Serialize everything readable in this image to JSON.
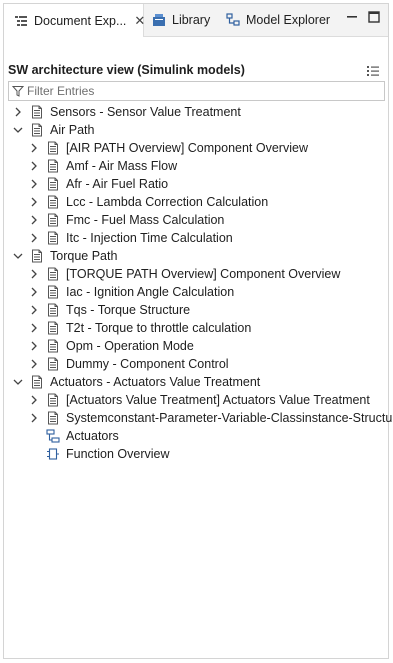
{
  "tabs": [
    {
      "label": "Document Exp...",
      "icon": "tree-view-icon"
    },
    {
      "label": "Library",
      "icon": "library-icon"
    },
    {
      "label": "Model Explorer",
      "icon": "model-explorer-icon"
    }
  ],
  "view": {
    "title": "SW architecture view (Simulink models)",
    "filter_placeholder": "Filter Entries"
  },
  "tree": [
    {
      "label": "Sensors - Sensor Value Treatment",
      "level": 0,
      "expander": "collapsed",
      "icon": "document-icon"
    },
    {
      "label": "Air Path",
      "level": 0,
      "expander": "expanded",
      "icon": "document-icon"
    },
    {
      "label": "[AIR PATH Overview] Component Overview",
      "level": 1,
      "expander": "collapsed",
      "icon": "document-icon"
    },
    {
      "label": "Amf - Air Mass Flow",
      "level": 1,
      "expander": "collapsed",
      "icon": "document-icon"
    },
    {
      "label": "Afr - Air Fuel Ratio",
      "level": 1,
      "expander": "collapsed",
      "icon": "document-icon"
    },
    {
      "label": "Lcc - Lambda Correction Calculation",
      "level": 1,
      "expander": "collapsed",
      "icon": "document-icon"
    },
    {
      "label": "Fmc - Fuel Mass Calculation",
      "level": 1,
      "expander": "collapsed",
      "icon": "document-icon"
    },
    {
      "label": "Itc - Injection Time Calculation",
      "level": 1,
      "expander": "collapsed",
      "icon": "document-icon"
    },
    {
      "label": "Torque Path",
      "level": 0,
      "expander": "expanded",
      "icon": "document-icon"
    },
    {
      "label": "[TORQUE PATH Overview] Component Overview",
      "level": 1,
      "expander": "collapsed",
      "icon": "document-icon"
    },
    {
      "label": "Iac - Ignition Angle Calculation",
      "level": 1,
      "expander": "collapsed",
      "icon": "document-icon"
    },
    {
      "label": "Tqs - Torque Structure",
      "level": 1,
      "expander": "collapsed",
      "icon": "document-icon"
    },
    {
      "label": "T2t - Torque to throttle calculation",
      "level": 1,
      "expander": "collapsed",
      "icon": "document-icon"
    },
    {
      "label": "Opm - Operation Mode",
      "level": 1,
      "expander": "collapsed",
      "icon": "document-icon"
    },
    {
      "label": "Dummy - Component Control",
      "level": 1,
      "expander": "collapsed",
      "icon": "document-icon"
    },
    {
      "label": "Actuators - Actuators Value Treatment",
      "level": 0,
      "expander": "expanded",
      "icon": "document-icon"
    },
    {
      "label": "[Actuators Value Treatment] Actuators Value Treatment",
      "level": 1,
      "expander": "collapsed",
      "icon": "document-icon"
    },
    {
      "label": "Systemconstant-Parameter-Variable-Classinstance-Structure",
      "level": 1,
      "expander": "collapsed",
      "icon": "document-icon"
    },
    {
      "label": "Actuators",
      "level": 1,
      "expander": "none",
      "icon": "hierarchy-icon"
    },
    {
      "label": "Function Overview",
      "level": 1,
      "expander": "none",
      "icon": "function-block-icon"
    }
  ]
}
